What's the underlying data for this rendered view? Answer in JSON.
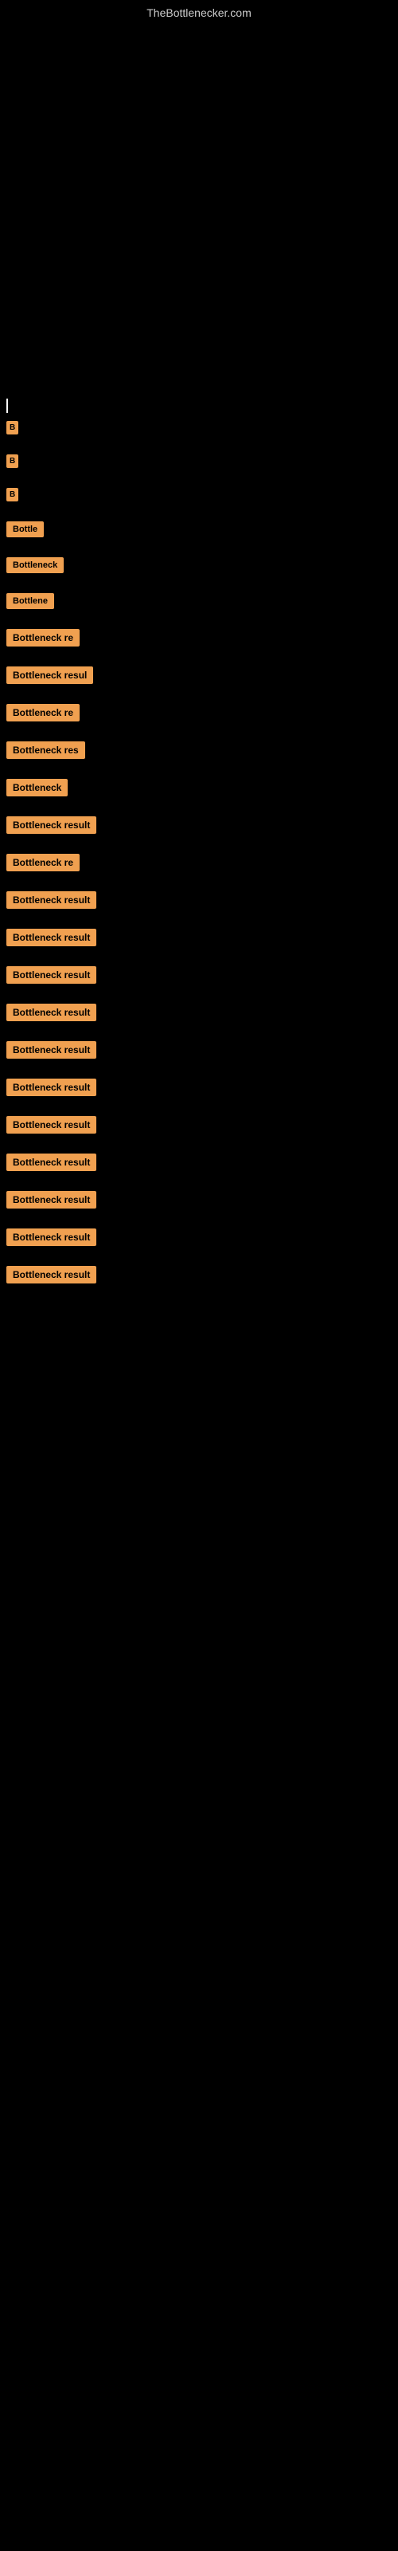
{
  "site": {
    "title": "TheBottlenecker.com"
  },
  "items": [
    {
      "id": 1,
      "label": "B"
    },
    {
      "id": 2,
      "label": "B"
    },
    {
      "id": 3,
      "label": "B"
    },
    {
      "id": 4,
      "label": "Bottle"
    },
    {
      "id": 5,
      "label": "Bottleneck"
    },
    {
      "id": 6,
      "label": "Bottlene"
    },
    {
      "id": 7,
      "label": "Bottleneck re"
    },
    {
      "id": 8,
      "label": "Bottleneck resul"
    },
    {
      "id": 9,
      "label": "Bottleneck re"
    },
    {
      "id": 10,
      "label": "Bottleneck res"
    },
    {
      "id": 11,
      "label": "Bottleneck"
    },
    {
      "id": 12,
      "label": "Bottleneck result"
    },
    {
      "id": 13,
      "label": "Bottleneck re"
    },
    {
      "id": 14,
      "label": "Bottleneck result"
    },
    {
      "id": 15,
      "label": "Bottleneck result"
    },
    {
      "id": 16,
      "label": "Bottleneck result"
    },
    {
      "id": 17,
      "label": "Bottleneck result"
    },
    {
      "id": 18,
      "label": "Bottleneck result"
    },
    {
      "id": 19,
      "label": "Bottleneck result"
    },
    {
      "id": 20,
      "label": "Bottleneck result"
    },
    {
      "id": 21,
      "label": "Bottleneck result"
    },
    {
      "id": 22,
      "label": "Bottleneck result"
    },
    {
      "id": 23,
      "label": "Bottleneck result"
    },
    {
      "id": 24,
      "label": "Bottleneck result"
    }
  ]
}
